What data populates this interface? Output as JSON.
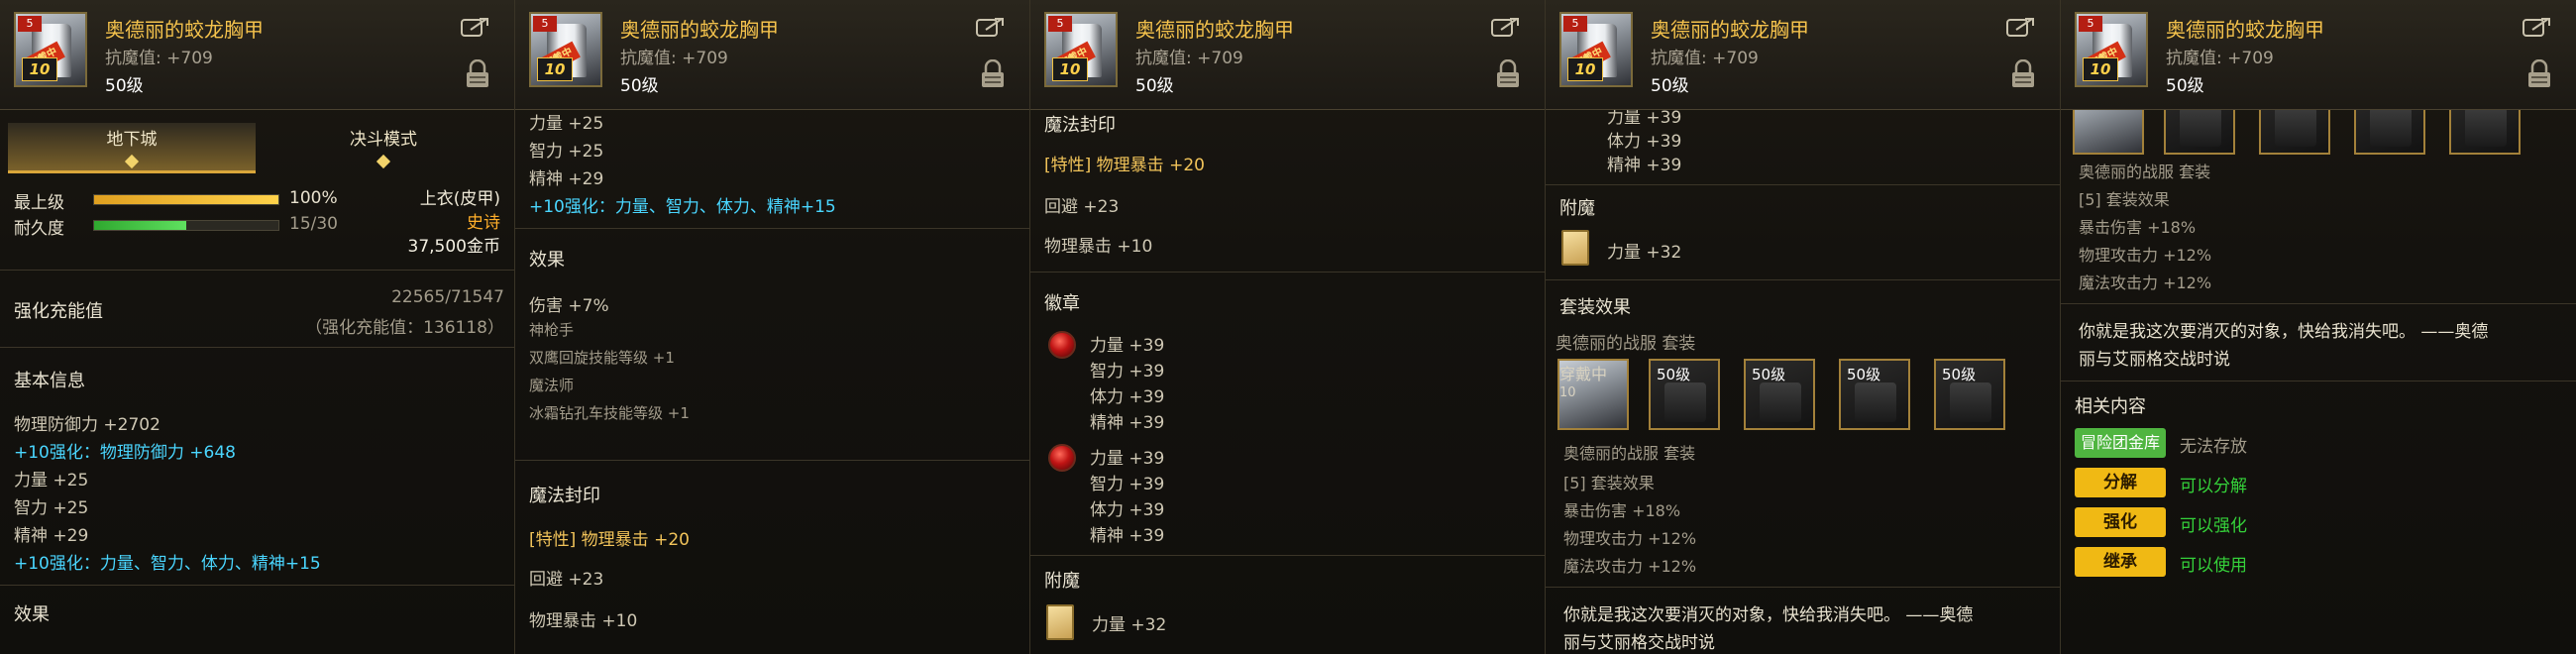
{
  "item": {
    "name": "奥德丽的蛟龙胸甲",
    "resist": "抗魔值: +709",
    "level": "50级",
    "badge_level": "5",
    "stamp": "穿戴中",
    "enhance": "10"
  },
  "p1": {
    "tab_dungeon": "地下城",
    "tab_duel": "决斗模式",
    "max_label": "最上级",
    "max_value": "100%",
    "max_fill": 100,
    "dur_label": "耐久度",
    "dur_value": "15/30",
    "dur_fill": 50,
    "slot": "上衣(皮甲)",
    "rarity": "史诗",
    "price": "37,500金币",
    "charge_label": "强化充能值",
    "charge_value": "22565/71547",
    "charge_sub": "（强化充能值：136118）",
    "basic_title": "基本信息",
    "lines": [
      "物理防御力 +2702",
      "+10强化：物理防御力 +648",
      "力量 +25",
      "智力 +25",
      "精神 +29",
      "+10强化：力量、智力、体力、精神+15"
    ],
    "effect_title": "效果"
  },
  "p2": {
    "top": [
      "力量 +25",
      "智力 +25",
      "精神 +29"
    ],
    "enh": "+10强化：力量、智力、体力、精神+15",
    "effect_title": "效果",
    "effects": [
      "伤害 +7%",
      "神枪手",
      "双鹰回旋技能等级 +1",
      "魔法师",
      "冰霜钻孔车技能等级 +1"
    ],
    "seal_title": "魔法封印",
    "seal_line": "[特性] 物理暴击 +20",
    "evade": "回避 +23",
    "crit": "物理暴击 +10"
  },
  "p3": {
    "seal_title": "魔法封印",
    "seal_line": "[特性] 物理暴击 +20",
    "evade": "回避 +23",
    "crit": "物理暴击 +10",
    "emblem_title": "徽章",
    "emblem1": [
      "力量 +39",
      "智力 +39",
      "体力 +39",
      "精神 +39"
    ],
    "emblem2": [
      "力量 +39",
      "智力 +39",
      "体力 +39",
      "精神 +39"
    ],
    "enchant_title": "附魔",
    "enchant": "力量 +32"
  },
  "p4": {
    "top": [
      "力量 +39",
      "体力 +39",
      "精神 +39"
    ],
    "enchant_title": "附魔",
    "enchant": "力量 +32",
    "set_title": "套装效果",
    "set_name": "奥德丽的战服  套装",
    "slot_lvls": [
      "50级",
      "50级",
      "50级",
      "50级"
    ],
    "set_name2": "奥德丽的战服  套装",
    "set_lines": [
      "[5] 套装效果",
      "暴击伤害 +18%",
      "物理攻击力 +12%",
      "魔法攻击力 +12%"
    ],
    "quote1": "你就是我这次要消灭的对象，快给我消失吧。 ——奥德",
    "quote2": "丽与艾丽格交战时说"
  },
  "p5": {
    "set_name": "奥德丽的战服  套装",
    "set_lines": [
      "[5] 套装效果",
      "暴击伤害 +18%",
      "物理攻击力 +12%",
      "魔法攻击力 +12%"
    ],
    "quote1": "你就是我这次要消灭的对象，快给我消失吧。 ——奥德",
    "quote2": "丽与艾丽格交战时说",
    "related_title": "相关内容",
    "btn_storage": "冒险团金库",
    "storage_status": "无法存放",
    "btn_split": "分解",
    "split_status": "可以分解",
    "btn_enhance": "强化",
    "enhance_status": "可以强化",
    "btn_inherit": "继承",
    "inherit_status": "可以使用"
  }
}
